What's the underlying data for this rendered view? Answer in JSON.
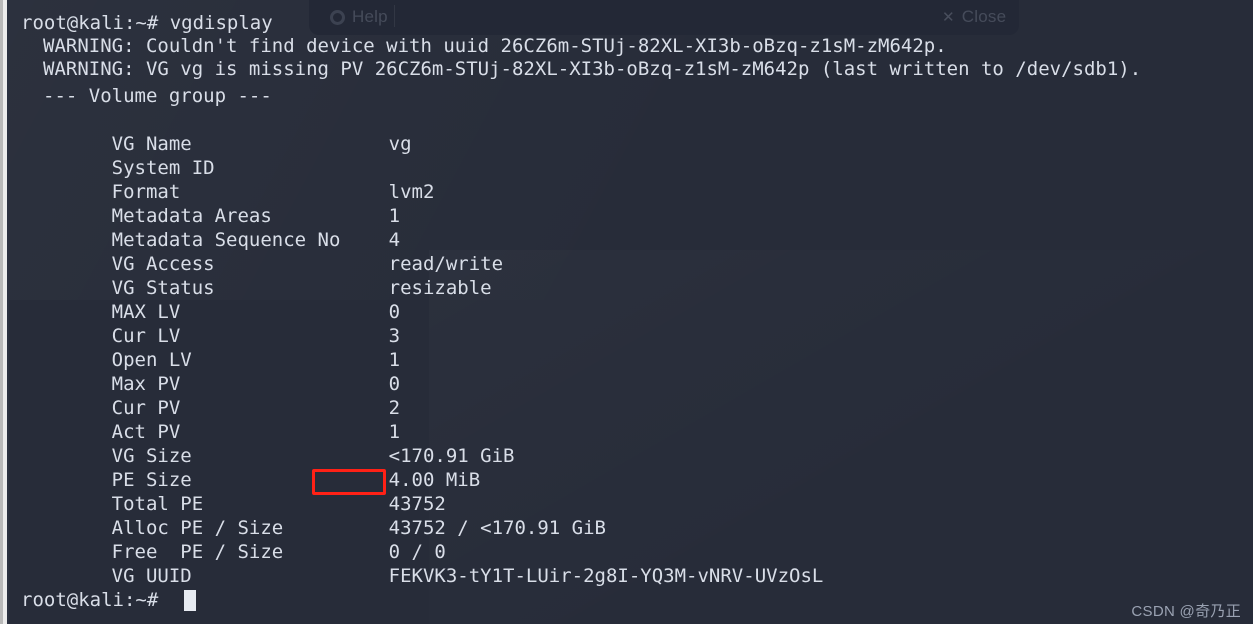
{
  "terminal": {
    "prompt_top": "root@kali:~# vgdisplay",
    "prompt_bottom": "root@kali:~#",
    "colors": {
      "background": "#272c39",
      "foreground": "#d9dee8",
      "annotation": "#ff2116"
    },
    "warnings": [
      "WARNING: Couldn't find device with uuid 26CZ6m-STUj-82XL-XI3b-oBzq-z1sM-zM642p.",
      "WARNING: VG vg is missing PV 26CZ6m-STUj-82XL-XI3b-oBzq-z1sM-zM642p (last written to /dev/sdb1)."
    ],
    "section_header": "--- Volume group ---",
    "fields": [
      {
        "label": "VG Name",
        "value": "vg"
      },
      {
        "label": "System ID",
        "value": ""
      },
      {
        "label": "Format",
        "value": "lvm2"
      },
      {
        "label": "Metadata Areas",
        "value": "1"
      },
      {
        "label": "Metadata Sequence No",
        "value": "4"
      },
      {
        "label": "VG Access",
        "value": "read/write"
      },
      {
        "label": "VG Status",
        "value": "resizable"
      },
      {
        "label": "MAX LV",
        "value": "0"
      },
      {
        "label": "Cur LV",
        "value": "3"
      },
      {
        "label": "Open LV",
        "value": "1"
      },
      {
        "label": "Max PV",
        "value": "0"
      },
      {
        "label": "Cur PV",
        "value": "2"
      },
      {
        "label": "Act PV",
        "value": "1"
      },
      {
        "label": "VG Size",
        "value": "<170.91 GiB"
      },
      {
        "label": "PE Size",
        "value": "4.00 MiB"
      },
      {
        "label": "Total PE",
        "value": "43752"
      },
      {
        "label": "Alloc PE / Size",
        "value": "43752 / <170.91 GiB"
      },
      {
        "label": "Free  PE / Size",
        "value": "0 / 0"
      },
      {
        "label": "VG UUID",
        "value": "FEKVK3-tY1T-LUir-2g8I-YQ3M-vNRV-UVzOsL"
      }
    ],
    "cursor": "block"
  },
  "ghost_dialog": {
    "help_label": "Help",
    "close_label": "Close",
    "close_glyph": "✕"
  },
  "watermark": {
    "text": "CSDN @奇乃正"
  }
}
